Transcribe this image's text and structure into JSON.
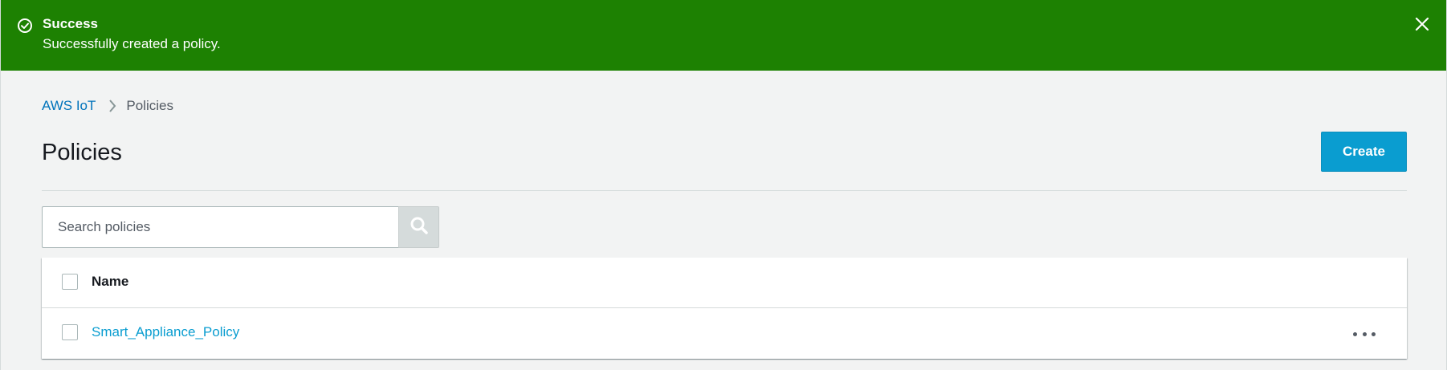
{
  "banner": {
    "title": "Success",
    "message": "Successfully created a policy.",
    "status_icon": "check-circle-icon",
    "close_icon": "close-icon",
    "color": "#1d8102"
  },
  "breadcrumb": {
    "items": [
      {
        "label": "AWS IoT"
      },
      {
        "label": "Policies"
      }
    ],
    "separator_icon": "chevron-right-icon"
  },
  "page": {
    "title": "Policies",
    "create_label": "Create",
    "accent": "#0a9dd0"
  },
  "search": {
    "placeholder": "Search policies",
    "value": "",
    "icon": "search-icon"
  },
  "table": {
    "columns": [
      {
        "label": "Name"
      }
    ],
    "rows": [
      {
        "name": "Smart_Appliance_Policy",
        "actions_icon": "more-horizontal-icon"
      }
    ]
  }
}
